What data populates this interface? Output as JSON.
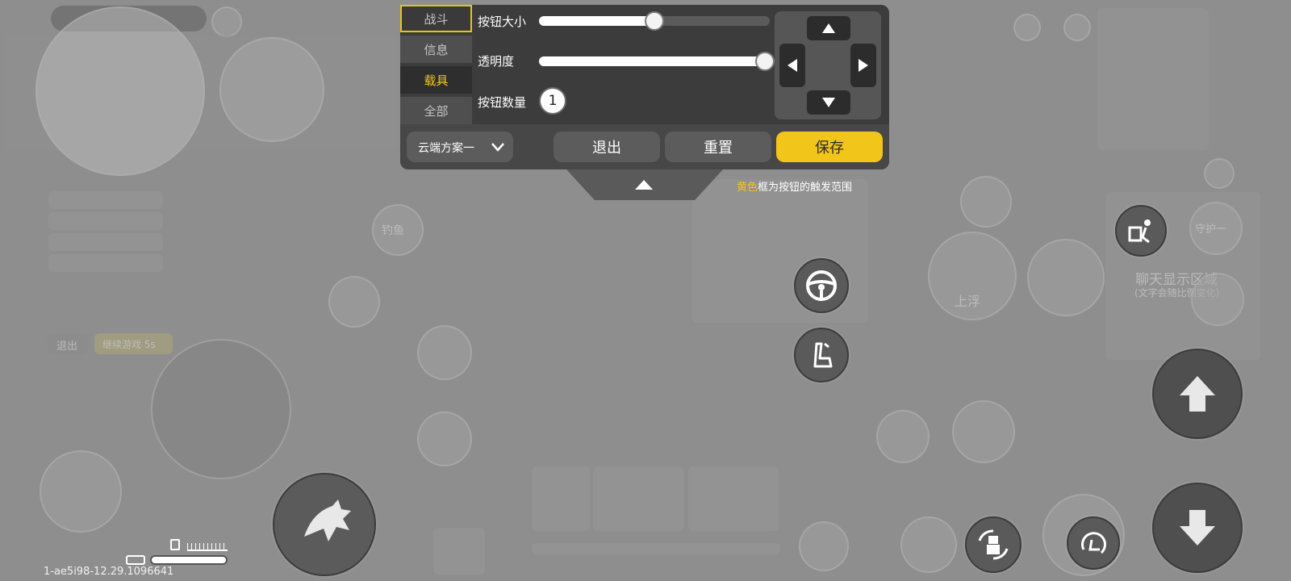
{
  "tabs": [
    {
      "label": "战斗",
      "state": "selected"
    },
    {
      "label": "信息",
      "state": "normal"
    },
    {
      "label": "载具",
      "state": "active"
    },
    {
      "label": "全部",
      "state": "normal"
    }
  ],
  "settings": {
    "size_label": "按钮大小",
    "size_value": 0.5,
    "opacity_label": "透明度",
    "opacity_value": 0.98,
    "count_label": "按钮数量",
    "count_value": "1"
  },
  "scheme": {
    "selected": "云端方案一",
    "icon": "chevron-down-icon"
  },
  "actions": {
    "exit": "退出",
    "reset": "重置",
    "save": "保存"
  },
  "hint": {
    "highlight": "黄色",
    "rest": "框为按钮的触发范围"
  },
  "background": {
    "ghost_labels": [
      "上浮",
      "聊天显示区域",
      "(文字会随比例变化)",
      "退出",
      "继续游戏 5s",
      "守护一",
      "钓鱼"
    ],
    "build_id": "1-ae5i98-12.29.1096641"
  },
  "colors": {
    "accent": "#f2c51a",
    "panel": "#3c3c3c",
    "tab": "#4f4f4f"
  }
}
